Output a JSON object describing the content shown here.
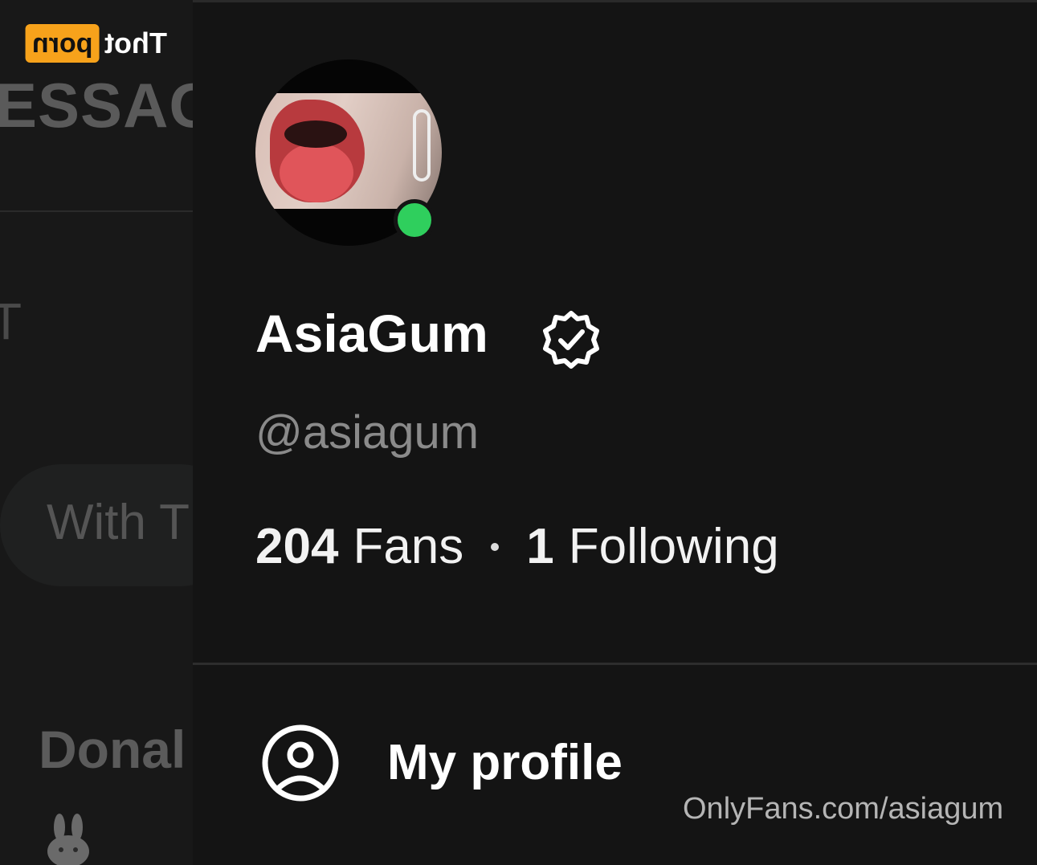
{
  "logo": {
    "badge": "porn",
    "text": "Thot"
  },
  "background_page": {
    "title_fragment": "ESSAG",
    "tab_fragment": "T",
    "filter_pill_fragment": "With T",
    "chat_name_fragment": "Donal",
    "chat_emoji_icon": "rabbit-icon"
  },
  "profile": {
    "display_name": "AsiaGum",
    "verified_icon": "verified-badge-icon",
    "username": "@asiagum",
    "online_status_color": "#2fcf5d",
    "stats": {
      "fans_count": "204",
      "fans_label": "Fans",
      "following_count": "1",
      "following_label": "Following"
    }
  },
  "menu": {
    "items": [
      {
        "label": "My profile",
        "icon": "user-circle-icon"
      }
    ]
  },
  "watermark": {
    "text": "OnlyFans.com/asiagum"
  },
  "colors": {
    "background": "#121212",
    "panel": "#141414",
    "text_primary": "#ffffff",
    "text_secondary": "#8a8a8a",
    "online": "#2fcf5d",
    "logo_accent": "#f7a21b"
  }
}
